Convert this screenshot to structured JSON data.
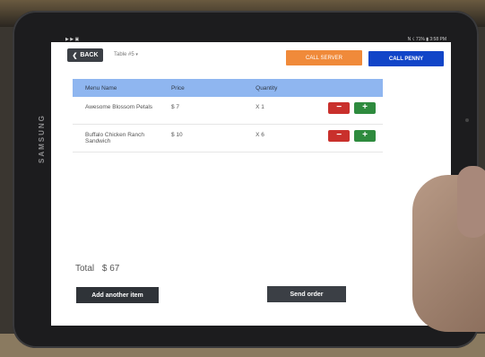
{
  "statusbar": {
    "left": "▶ ▶ ▣",
    "right": "N ☇ 71% ▮ 3:58 PM"
  },
  "device": {
    "brand": "SAMSUNG"
  },
  "header": {
    "back_label": "BACK",
    "table_select": "Table #5",
    "call_server_label": "CALL SERVER",
    "call_penny_label": "CALL PENNY"
  },
  "table": {
    "headers": [
      "Menu Name",
      "Price",
      "Quantity"
    ],
    "rows": [
      {
        "name": "Awesome Blossom Petals",
        "price": "$ 7",
        "qty": "X 1"
      },
      {
        "name": "Buffalo Chicken Ranch Sandwich",
        "price": "$ 10",
        "qty": "X 6"
      }
    ]
  },
  "buttons": {
    "minus": "−",
    "plus": "+"
  },
  "footer": {
    "total_label": "Total",
    "total_amount": "$ 67",
    "add_item_label": "Add another item",
    "send_order_label": "Send order"
  },
  "colors": {
    "call_server": "#f08a3a",
    "call_penny": "#1145c8",
    "table_header": "#8fb6f0",
    "minus": "#c9302c",
    "plus": "#2e8b3e",
    "dark_button": "#3b3f45"
  }
}
